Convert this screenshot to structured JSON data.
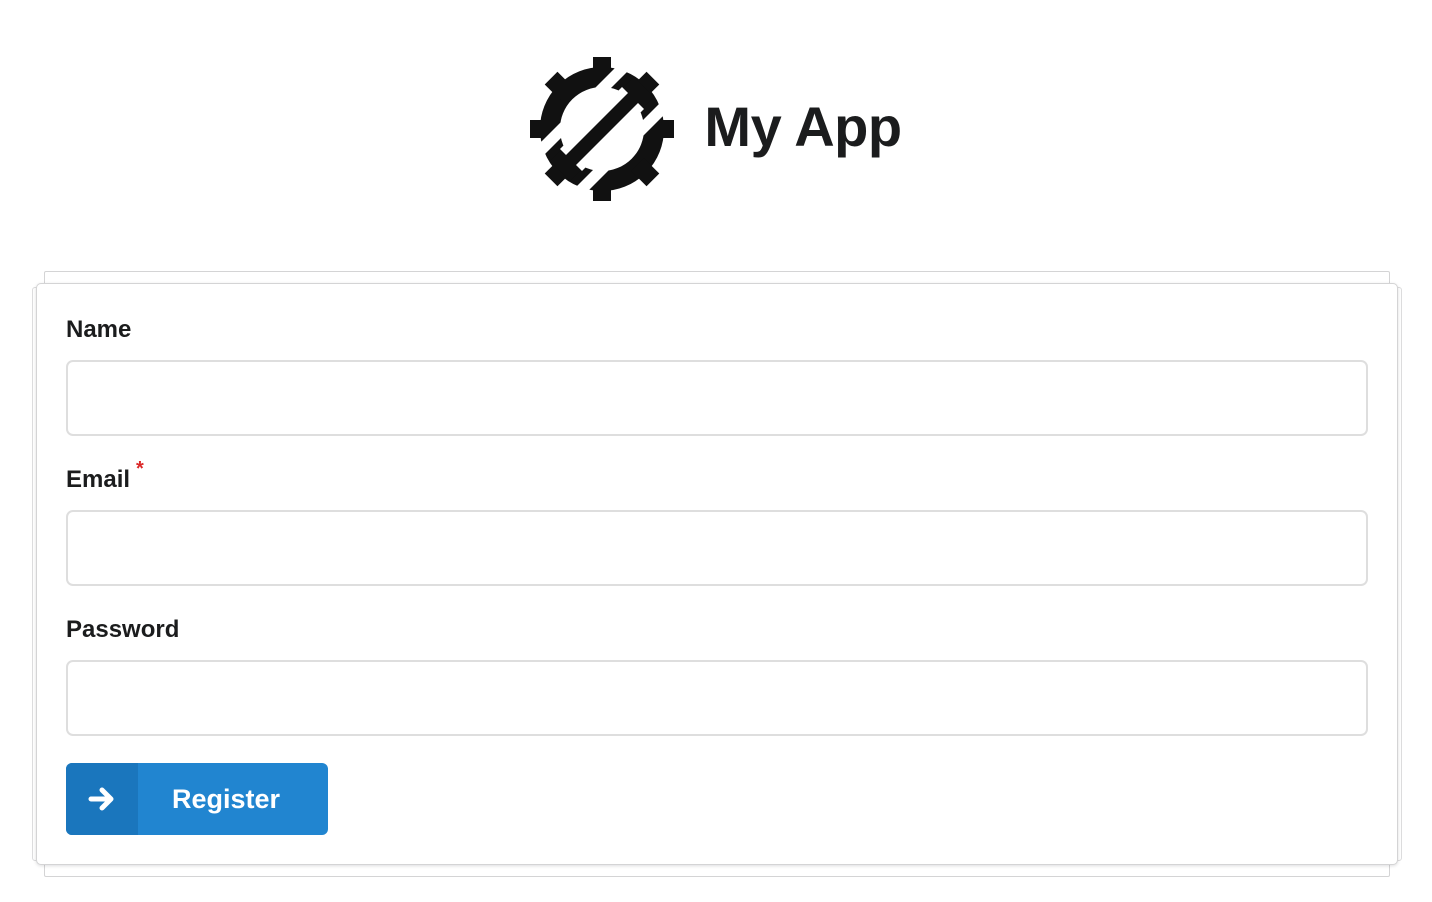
{
  "header": {
    "title": "My App",
    "logo_icon": "gear-slash-logo-icon"
  },
  "form": {
    "name": {
      "label": "Name",
      "value": "",
      "required": false
    },
    "email": {
      "label": "Email",
      "required_marker": "*",
      "value": "",
      "required": true
    },
    "password": {
      "label": "Password",
      "value": "",
      "required": false
    },
    "submit": {
      "label": "Register",
      "icon": "arrow-right-icon"
    }
  },
  "colors": {
    "primary": "#2185d0",
    "primary_dark": "#1a76bd",
    "required": "#db2828",
    "text": "#1b1c1d",
    "border": "#dedede"
  }
}
